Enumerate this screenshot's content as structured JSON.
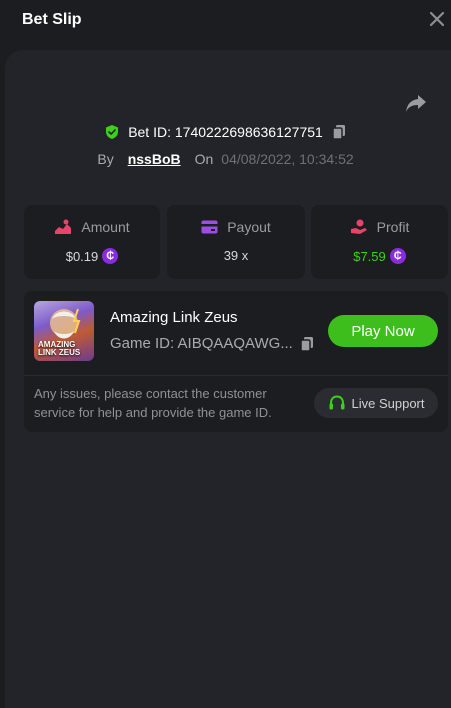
{
  "header": {
    "title": "Bet Slip"
  },
  "bet": {
    "id_label": "Bet ID: 1740222698636127751",
    "by_label": "By",
    "user": "nssBoB",
    "on_label": "On",
    "datetime": "04/08/2022, 10:34:52"
  },
  "stats": {
    "amount": {
      "label": "Amount",
      "value": "$0.19"
    },
    "payout": {
      "label": "Payout",
      "value": "39 x"
    },
    "profit": {
      "label": "Profit",
      "value": "$7.59"
    }
  },
  "game": {
    "thumb_text": "AMAZING LINK ZEUS",
    "name": "Amazing Link Zeus",
    "id_label": "Game ID: AIBQAAQAWG...",
    "play_label": "Play Now"
  },
  "support": {
    "message": "Any issues, please contact the customer service for help and provide the game ID.",
    "button_label": "Live Support"
  },
  "colors": {
    "accent_green": "#3dbe1d",
    "profit_green": "#3dd11b",
    "coin_purple": "#8a2be2"
  }
}
